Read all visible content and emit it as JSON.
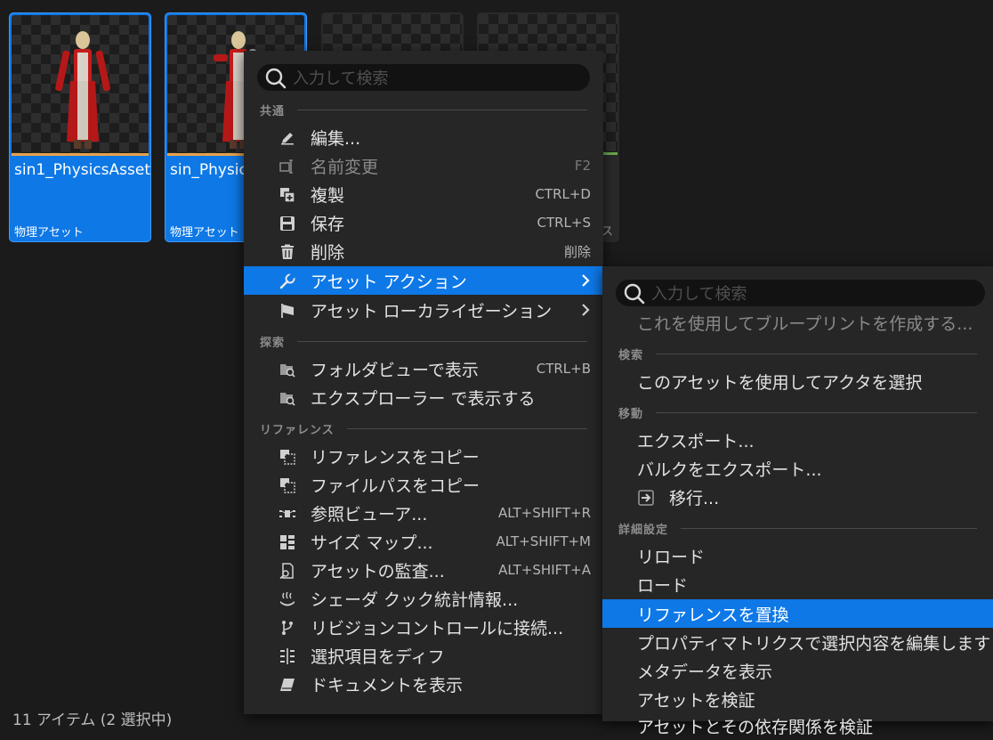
{
  "assets": [
    {
      "name": "sin1_PhysicsAsset",
      "type": "物理アセット"
    },
    {
      "name": "sin_Physic",
      "type": "物理アセット"
    },
    {
      "name": "",
      "type": "ス"
    }
  ],
  "status_bar": "11 アイテム (2 選択中)",
  "main_menu": {
    "search_placeholder": "入力して検索",
    "sections": {
      "common": "共通",
      "explore": "探索",
      "references": "リファレンス"
    },
    "items": {
      "edit": {
        "label": "編集...",
        "icon": "pencil-icon"
      },
      "rename": {
        "label": "名前変更",
        "shortcut": "F2",
        "icon": "rename-icon"
      },
      "duplicate": {
        "label": "複製",
        "shortcut": "CTRL+D",
        "icon": "duplicate-icon"
      },
      "save": {
        "label": "保存",
        "shortcut": "CTRL+S",
        "icon": "save-icon"
      },
      "delete": {
        "label": "削除",
        "shortcut": "削除",
        "icon": "trash-icon"
      },
      "asset_actions": {
        "label": "アセット アクション",
        "icon": "wrench-icon"
      },
      "asset_localization": {
        "label": "アセット ローカライゼーション",
        "icon": "flag-icon"
      },
      "show_in_folder_view": {
        "label": "フォルダビューで表示",
        "shortcut": "CTRL+B",
        "icon": "folder-search-icon"
      },
      "show_in_explorer": {
        "label": "エクスプローラー で表示する",
        "icon": "folder-search-icon"
      },
      "copy_reference": {
        "label": "リファレンスをコピー",
        "icon": "copy-reference-icon"
      },
      "copy_file_path": {
        "label": "ファイルパスをコピー",
        "icon": "copy-reference-icon"
      },
      "reference_viewer": {
        "label": "参照ビューア...",
        "shortcut": "ALT+SHIFT+R",
        "icon": "reference-viewer-icon"
      },
      "size_map": {
        "label": "サイズ マップ...",
        "shortcut": "ALT+SHIFT+M",
        "icon": "size-map-icon"
      },
      "audit_assets": {
        "label": "アセットの監査...",
        "shortcut": "ALT+SHIFT+A",
        "icon": "audit-icon"
      },
      "shader_cook_stats": {
        "label": "シェーダ クック統計情報...",
        "icon": "shader-icon"
      },
      "connect_source_control": {
        "label": "リビジョンコントロールに接続...",
        "icon": "branch-icon"
      },
      "diff_selected": {
        "label": "選択項目をディフ",
        "icon": "diff-icon"
      },
      "view_documentation": {
        "label": "ドキュメントを表示",
        "icon": "book-icon"
      }
    }
  },
  "sub_menu": {
    "search_placeholder": "入力して検索",
    "create_blueprint": "これを使用してブループリントを作成する...",
    "sections": {
      "search": "検索",
      "move": "移動",
      "advanced": "詳細設定"
    },
    "items": {
      "select_actors": "このアセットを使用してアクタを選択",
      "export": "エクスポート...",
      "bulk_export": "バルクをエクスポート...",
      "migrate": "移行...",
      "reload": "リロード",
      "load": "ロード",
      "replace_references": "リファレンスを置換",
      "property_matrix": "プロパティマトリクスで選択内容を編集します",
      "show_metadata": "メタデータを表示",
      "validate_assets": "アセットを検証",
      "validate_dependencies": "アセットとその依存関係を検証"
    }
  },
  "colors": {
    "highlight": "#0e78e6",
    "menu_bg": "#262626",
    "asset_type_bar": "#e9a14b"
  }
}
